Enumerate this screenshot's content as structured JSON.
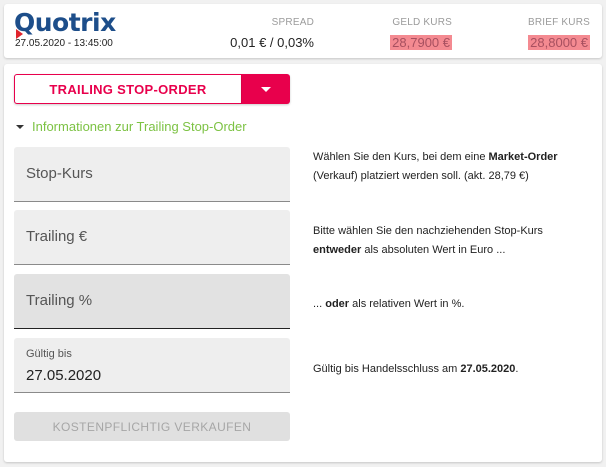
{
  "header": {
    "logo_text": "Quotrix",
    "timestamp": "27.05.2020 - 13:45:00",
    "spread": {
      "label": "SPREAD",
      "value": "0,01 € / 0,03%"
    },
    "geld": {
      "label": "GELD KURS",
      "value": "28,7900 €"
    },
    "brief": {
      "label": "BRIEF KURS",
      "value": "28,8000 €"
    }
  },
  "order": {
    "type_label": "TRAILING STOP-ORDER",
    "info_link": "Informationen zur Trailing Stop-Order"
  },
  "fields": {
    "stop_kurs": {
      "label": "Stop-Kurs"
    },
    "trailing_eur": {
      "label": "Trailing €"
    },
    "trailing_pct": {
      "label": "Trailing %"
    },
    "gueltig": {
      "label": "Gültig bis",
      "value": "27.05.2020"
    }
  },
  "descriptions": {
    "stop_kurs": {
      "pre": "Wählen Sie den Kurs, bei dem eine ",
      "bold": "Market-Order",
      "post": " (Verkauf) platziert werden soll. (akt. 28,79 €)"
    },
    "trailing_eur": {
      "pre": "Bitte wählen Sie den nachziehenden Stop-Kurs ",
      "bold": "entweder",
      "post": " als absoluten Wert in Euro ..."
    },
    "trailing_pct": {
      "pre": "... ",
      "bold": "oder",
      "post": " als relativen Wert in %."
    },
    "gueltig": {
      "pre": "Gültig bis Handelsschluss am ",
      "bold": "27.05.2020",
      "post": "."
    }
  },
  "actions": {
    "sell_label": "KOSTENPFLICHTIG VERKAUFEN"
  },
  "colors": {
    "accent": "#e8004c",
    "info_green": "#7cc243",
    "price_highlight": "#f48a91",
    "logo_blue": "#1d4e8a"
  }
}
